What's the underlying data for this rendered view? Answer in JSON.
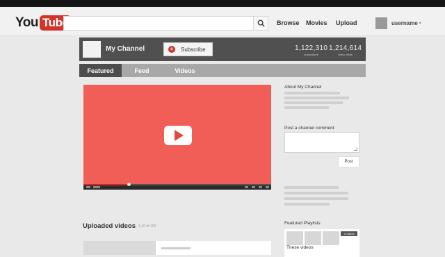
{
  "masthead": {
    "logo_you": "You",
    "logo_tube": "Tube",
    "search_placeholder": "",
    "nav": [
      "Browse",
      "Movies",
      "Upload"
    ],
    "username": "username",
    "caret": "▾"
  },
  "channel": {
    "name": "My Channel",
    "subscribe_label": "Subscribe",
    "subscribe_icon": "+",
    "subscribers": "1,122,310",
    "subscribers_label": "subscribers",
    "video_views": "1,214,614",
    "video_views_label": "video views"
  },
  "tabs": [
    "Featured",
    "Feed",
    "Videos"
  ],
  "player": {
    "progress_fraction": 0.24
  },
  "sidebar": {
    "about_heading": "About My Channel",
    "comment_heading": "Post a channel comment",
    "post_label": "Post",
    "featured_playlists_heading": "Featured Playlists",
    "playlist_title": "These videos",
    "playlist_badge": "5 videos"
  },
  "uploaded": {
    "title": "Uploaded videos",
    "count": "1-10 of 102"
  },
  "colors": {
    "accent": "#d3342a",
    "player": "#f05e57",
    "channel_bar": "#505050"
  }
}
